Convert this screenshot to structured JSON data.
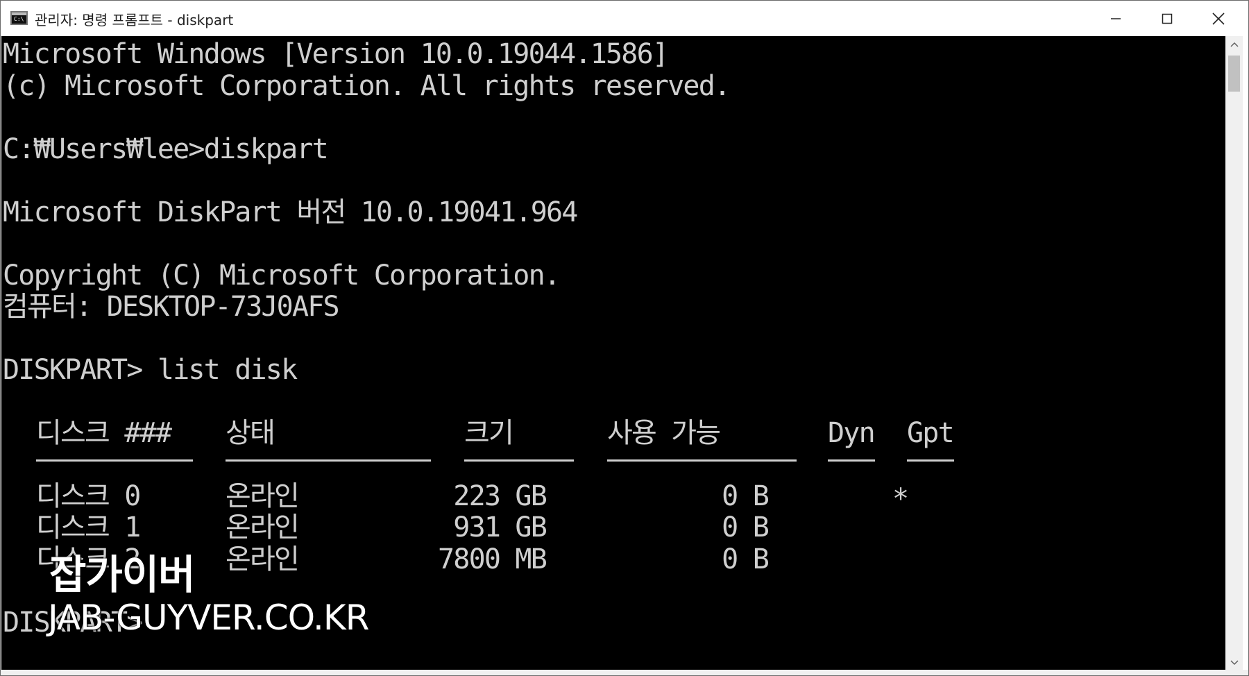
{
  "window": {
    "title": "관리자: 명령 프롬프트 - diskpart",
    "icon": "cmd-console-icon",
    "icon_glyph": "C:\\"
  },
  "controls": {
    "minimize": "minimize-icon",
    "maximize": "maximize-icon",
    "close": "close-icon"
  },
  "console": {
    "lines": [
      "Microsoft Windows [Version 10.0.19044.1586]",
      "(c) Microsoft Corporation. All rights reserved.",
      "C:₩Users₩lee>diskpart",
      "Microsoft DiskPart 버전 10.0.19041.964",
      "Copyright (C) Microsoft Corporation.",
      "컴퓨터: DESKTOP-73J0AFS",
      "DISKPART> list disk"
    ],
    "table": {
      "headers": [
        "디스크 ###",
        "상태",
        "크기",
        "사용 가능",
        "Dyn",
        "Gpt"
      ],
      "rows": [
        {
          "disk": "디스크 0",
          "status": "온라인",
          "size": "223 GB",
          "free": "0 B",
          "dyn": "",
          "gpt": "*"
        },
        {
          "disk": "디스크 1",
          "status": "온라인",
          "size": "931 GB",
          "free": "0 B",
          "dyn": "",
          "gpt": ""
        },
        {
          "disk": "디스크 2",
          "status": "온라인",
          "size": "7800 MB",
          "free": "0 B",
          "dyn": "",
          "gpt": ""
        }
      ]
    },
    "last_prompt": "DISKPART>"
  },
  "watermark": {
    "name": "잡가이버",
    "url": "JAB-GUYVER.CO.KR"
  },
  "colors": {
    "console_bg": "#000000",
    "console_text": "#cfcfcf",
    "titlebar_bg": "#ffffff"
  }
}
